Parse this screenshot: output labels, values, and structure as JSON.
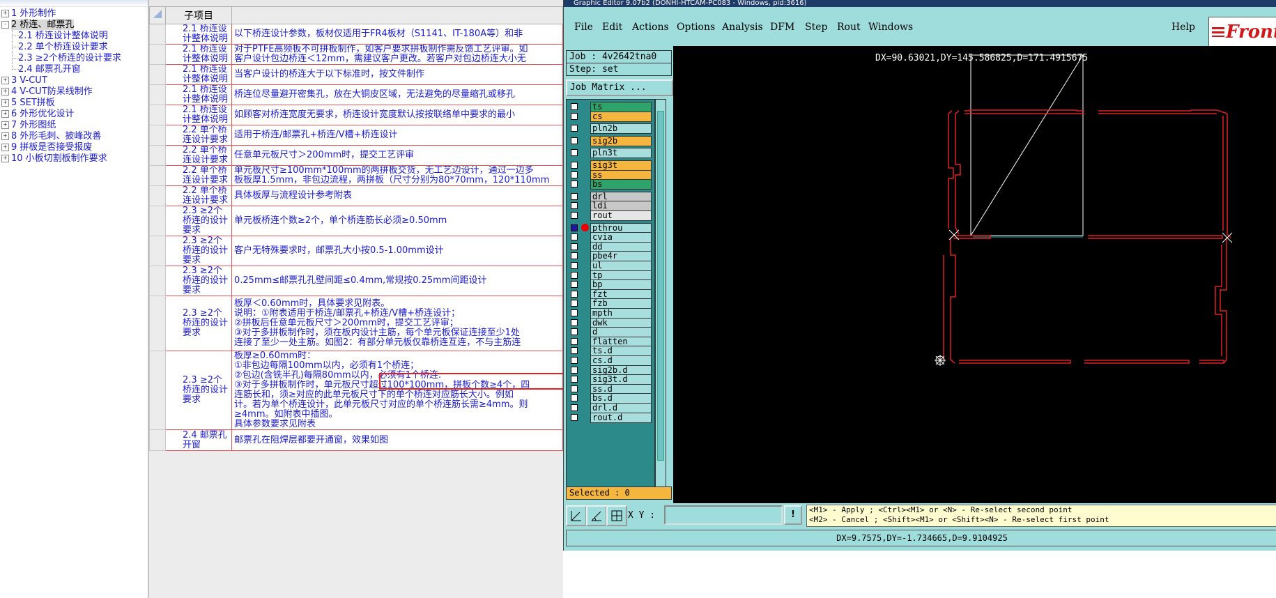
{
  "tree": {
    "nodes": [
      {
        "label": "1 外形制作",
        "expander": "+"
      },
      {
        "label": "2 桥连、邮票孔",
        "expander": "-",
        "selected": true
      },
      {
        "label": "2.1 桥连设计整体说明"
      },
      {
        "label": "2.2 单个桥连设计要求"
      },
      {
        "label": "2.3 ≥2个桥连的设计要求"
      },
      {
        "label": "2.4 邮票孔开窗"
      },
      {
        "label": "3 V-CUT",
        "expander": "+"
      },
      {
        "label": "4 V-CUT防呆线制作",
        "expander": "+"
      },
      {
        "label": "5 SET拼板",
        "expander": "+"
      },
      {
        "label": "6 外形优化设计",
        "expander": "+"
      },
      {
        "label": "7 外形图纸",
        "expander": "+"
      },
      {
        "label": "8 外形毛刺、披峰改善",
        "expander": "+"
      },
      {
        "label": "9 拼板是否接受报废",
        "expander": "+"
      },
      {
        "label": "10 小板切割板制作要求",
        "expander": "+"
      }
    ]
  },
  "grid": {
    "header": "子项目",
    "rows": [
      {
        "item": "2.1 桥连设计整体说明",
        "lines": [
          "以下桥连设计参数，板材仅适用于FR4板材（S1141、IT-180A等）和非"
        ]
      },
      {
        "item": "2.1 桥连设计整体说明",
        "lines": [
          "对于PTFE高频板不可拼板制作，如客户要求拼板制作需反馈工艺评审。如",
          "客户设计包边桥连＜12mm，需建议客户更改。若客户对包边桥连大小无"
        ]
      },
      {
        "item": "2.1 桥连设计整体说明",
        "lines": [
          "当客户设计的桥连大于以下标准时，按文件制作"
        ]
      },
      {
        "item": "2.1 桥连设计整体说明",
        "lines": [
          "桥连位尽量避开密集孔，放在大铜皮区域，无法避免的尽量缩孔或移孔"
        ]
      },
      {
        "item": "2.1 桥连设计整体说明",
        "lines": [
          "如顾客对桥连宽度无要求，桥连设计宽度默认按按联络单中要求的最小"
        ]
      },
      {
        "item": "2.2 单个桥连设计要求",
        "lines": [
          "适用于桥连/邮票孔+桥连/V槽+桥连设计"
        ]
      },
      {
        "item": "2.2 单个桥连设计要求",
        "lines": [
          "任意单元板尺寸＞200mm时，提交工艺评审"
        ]
      },
      {
        "item": "2.2 单个桥连设计要求",
        "lines": [
          "单元板尺寸≥100mm*100mm的两拼板交货，无工艺边设计，通过一边多",
          "板板厚1.5mm，非包边流程，两拼板（尺寸分别为80*70mm，120*110mm"
        ]
      },
      {
        "item": "2.2 单个桥连设计要求",
        "lines": [
          "具体板厚与流程设计参考附表"
        ]
      },
      {
        "item": "2.3 ≥2个桥连的设计要求",
        "lines": [
          "单元板桥连个数≥2个，单个桥连筋长必须≥0.50mm"
        ]
      },
      {
        "item": "2.3 ≥2个桥连的设计要求",
        "lines": [
          "客户无特殊要求时，邮票孔大小按0.5-1.00mm设计"
        ]
      },
      {
        "item": "2.3 ≥2个桥连的设计要求",
        "lines": [
          "0.25mm≤邮票孔孔壁间距≤0.4mm,常规按0.25mm间距设计"
        ]
      },
      {
        "item": "2.3 ≥2个桥连的设计要求",
        "lines": [
          "板厚＜0.60mm时，具体要求见附表。",
          "说明：①附表适用于桥连/邮票孔+桥连/V槽+桥连设计；",
          "②拼板后任意单元板尺寸＞200mm时，提交工艺评审；",
          "③对于多拼板制作时，须在板内设计主筋，每个单元板保证连接至少1处",
          "连接了至少一处主筋。如图2：有部分单元板仅靠桥连互连，不与主筋连"
        ]
      },
      {
        "item": "2.3 ≥2个桥连的设计要求",
        "lines": [
          "板厚≥0.60mm时：",
          "①非包边每隔100mm以内，必须有1个桥连；",
          "②包边(含铣半孔)每隔80mm以内，必须有1个桥连.",
          "③对于多拼板制作时，单元板尺寸超过100*100mm，拼板个数≥4个，四",
          "连筋长和，须≥对应的此单元板尺寸下的单个桥连对应筋长大小。例如",
          "计。若为单个桥连设计，此单元板尺寸对应的单个桥连筋长需≥4mm。则",
          "≥4mm。如附表中插图。",
          "具体参数要求见附表"
        ]
      },
      {
        "item": "2.4 邮票孔开窗",
        "lines": [
          "邮票孔在阻焊层都要开通窗，效果如图"
        ]
      }
    ]
  },
  "editor": {
    "title": "Graphic Editor 9.07b2 (DONHI-HTCAM-PC083 - Windows, pid:3616)",
    "menu": [
      "File",
      "Edit",
      "Actions",
      "Options",
      "Analysis",
      "DFM",
      "Step",
      "Rout",
      "Windows"
    ],
    "help": "Help",
    "logo": "Front",
    "job": "Job : 4v2642tna0",
    "step": "Step: set",
    "job_matrix": "Job Matrix ...",
    "selected": "Selected : 0",
    "measure_top": "DX=90.63021,DY=145.586825,D=171.4915675",
    "xy_label": "X Y :",
    "xy_value": "",
    "exclaim": "!",
    "hint1": "<M1> - Apply  ; <Ctrl><M1> or <N> - Re-select second point",
    "hint2": "<M2> - Cancel ; <Shift><M1> or <Shift><N> - Re-select first point",
    "status": "DX=9.7575,DY=-1.734665,D=9.9104925",
    "layers": [
      {
        "name": "ts",
        "color": "#2ea36b",
        "gap": 0
      },
      {
        "name": "cs",
        "color": "#f5b640",
        "gap": 0
      },
      {
        "name": "pln2b",
        "color": "#a8dede",
        "gap": 1
      },
      {
        "name": "sig2b",
        "color": "#f5b640",
        "gap": 1
      },
      {
        "name": "pln3t",
        "color": "#a8dede",
        "gap": 1
      },
      {
        "name": "sig3t",
        "color": "#f5b640",
        "gap": 1
      },
      {
        "name": "ss",
        "color": "#f5b640",
        "gap": 0
      },
      {
        "name": "bs",
        "color": "#2ea36b",
        "gap": 0
      },
      {
        "name": "drl",
        "color": "#c8c8c8",
        "gap": 1
      },
      {
        "name": "ldi",
        "color": "#c8c8c8",
        "gap": 0
      },
      {
        "name": "rout",
        "color": "#e6e6e6",
        "gap": 0
      },
      {
        "name": "pthrou",
        "color": "#a8dede",
        "gap": 1,
        "active": true
      },
      {
        "name": "cvia",
        "color": "#a8dede",
        "gap": 0
      },
      {
        "name": "dd",
        "color": "#a8dede",
        "gap": 0
      },
      {
        "name": "pbe4r",
        "color": "#a8dede",
        "gap": 0
      },
      {
        "name": "ul",
        "color": "#a8dede",
        "gap": 0
      },
      {
        "name": "tp",
        "color": "#a8dede",
        "gap": 0
      },
      {
        "name": "bp",
        "color": "#a8dede",
        "gap": 0
      },
      {
        "name": "fzt",
        "color": "#a8dede",
        "gap": 0
      },
      {
        "name": "fzb",
        "color": "#a8dede",
        "gap": 0
      },
      {
        "name": "mpth",
        "color": "#a8dede",
        "gap": 0
      },
      {
        "name": "dwk",
        "color": "#a8dede",
        "gap": 0
      },
      {
        "name": "d",
        "color": "#a8dede",
        "gap": 0
      },
      {
        "name": "flatten",
        "color": "#a8dede",
        "gap": 0
      },
      {
        "name": "ts.d",
        "color": "#a8dede",
        "gap": 0
      },
      {
        "name": "cs.d",
        "color": "#a8dede",
        "gap": 0
      },
      {
        "name": "sig2b.d",
        "color": "#a8dede",
        "gap": 0
      },
      {
        "name": "sig3t.d",
        "color": "#a8dede",
        "gap": 0
      },
      {
        "name": "ss.d",
        "color": "#a8dede",
        "gap": 0
      },
      {
        "name": "bs.d",
        "color": "#a8dede",
        "gap": 0
      },
      {
        "name": "drl.d",
        "color": "#a8dede",
        "gap": 0
      },
      {
        "name": "rout.d",
        "color": "#a8dede",
        "gap": 0
      }
    ]
  }
}
